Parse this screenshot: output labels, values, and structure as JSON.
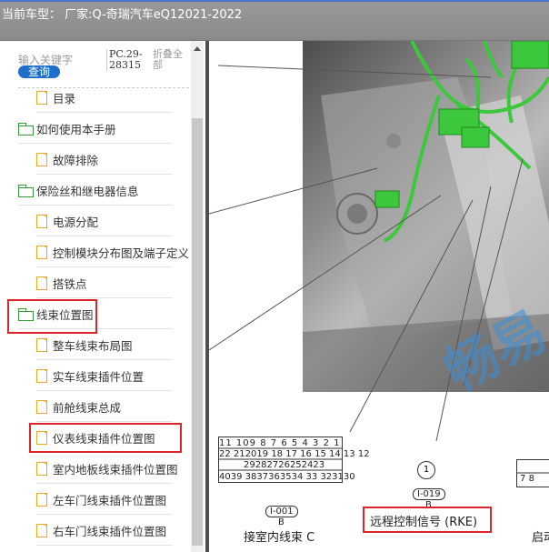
{
  "header": {
    "title": "当前车型： 厂家:Q-奇瑞汽车eQ12021-2022"
  },
  "search": {
    "placeholder": "输入关键字",
    "button_label": "查询",
    "pc_code": "PC.29-28315",
    "collapse_label": "折叠全部"
  },
  "tree": {
    "items": [
      {
        "label": "目录",
        "type": "page",
        "indent": 1
      },
      {
        "label": "如何使用本手册",
        "type": "folder",
        "indent": 0
      },
      {
        "label": "故障排除",
        "type": "page",
        "indent": 1
      },
      {
        "label": "保险丝和继电器信息",
        "type": "folder",
        "indent": 0
      },
      {
        "label": "电源分配",
        "type": "page",
        "indent": 1
      },
      {
        "label": "控制模块分布图及端子定义",
        "type": "page",
        "indent": 1
      },
      {
        "label": "搭铁点",
        "type": "page",
        "indent": 1
      },
      {
        "label": "线束位置图",
        "type": "folder",
        "indent": 0,
        "highlighted": true
      },
      {
        "label": "整车线束布局图",
        "type": "page",
        "indent": 1
      },
      {
        "label": "实车线束插件位置",
        "type": "page",
        "indent": 1
      },
      {
        "label": "前舱线束总成",
        "type": "page",
        "indent": 1
      },
      {
        "label": "仪表线束插件位置图",
        "type": "page",
        "indent": 1,
        "highlighted": true
      },
      {
        "label": "室内地板线束插件位置图",
        "type": "page",
        "indent": 1
      },
      {
        "label": "左车门线束插件位置图",
        "type": "page",
        "indent": 1
      },
      {
        "label": "右车门线束插件位置图",
        "type": "page",
        "indent": 1
      }
    ]
  },
  "diagram": {
    "watermark": "畅易",
    "connector_left": {
      "code": "I-001",
      "sub": "B",
      "caption": "接室内线束 C"
    },
    "connector_mid": {
      "code": "I-019",
      "sub": "B",
      "caption": "远程控制信号 (RKE)",
      "pin": "1"
    },
    "connector_right": {
      "caption": "启动"
    },
    "pins_row1": [
      "11",
      "10",
      "9",
      "8",
      "7",
      "6",
      "5",
      "4",
      "3",
      "2",
      "1"
    ],
    "pins_row2": [
      "22",
      "21",
      "20",
      "19",
      "18",
      "17",
      "16",
      "15",
      "14",
      "13",
      "12"
    ],
    "pins_row3": [
      "29",
      "28",
      "27",
      "26",
      "25",
      "24",
      "23"
    ],
    "pins_row4": [
      "40",
      "39",
      "38",
      "37",
      "36",
      "35",
      "34",
      "33",
      "32",
      "31",
      "30"
    ],
    "right_pins": [
      "7",
      "8"
    ]
  },
  "colors": {
    "highlight_box": "#d9262b",
    "search_button": "#1d6fc9",
    "harness_green": "#3cc83c",
    "folder_green": "#3a9a3a",
    "page_orange": "#e8a820"
  }
}
